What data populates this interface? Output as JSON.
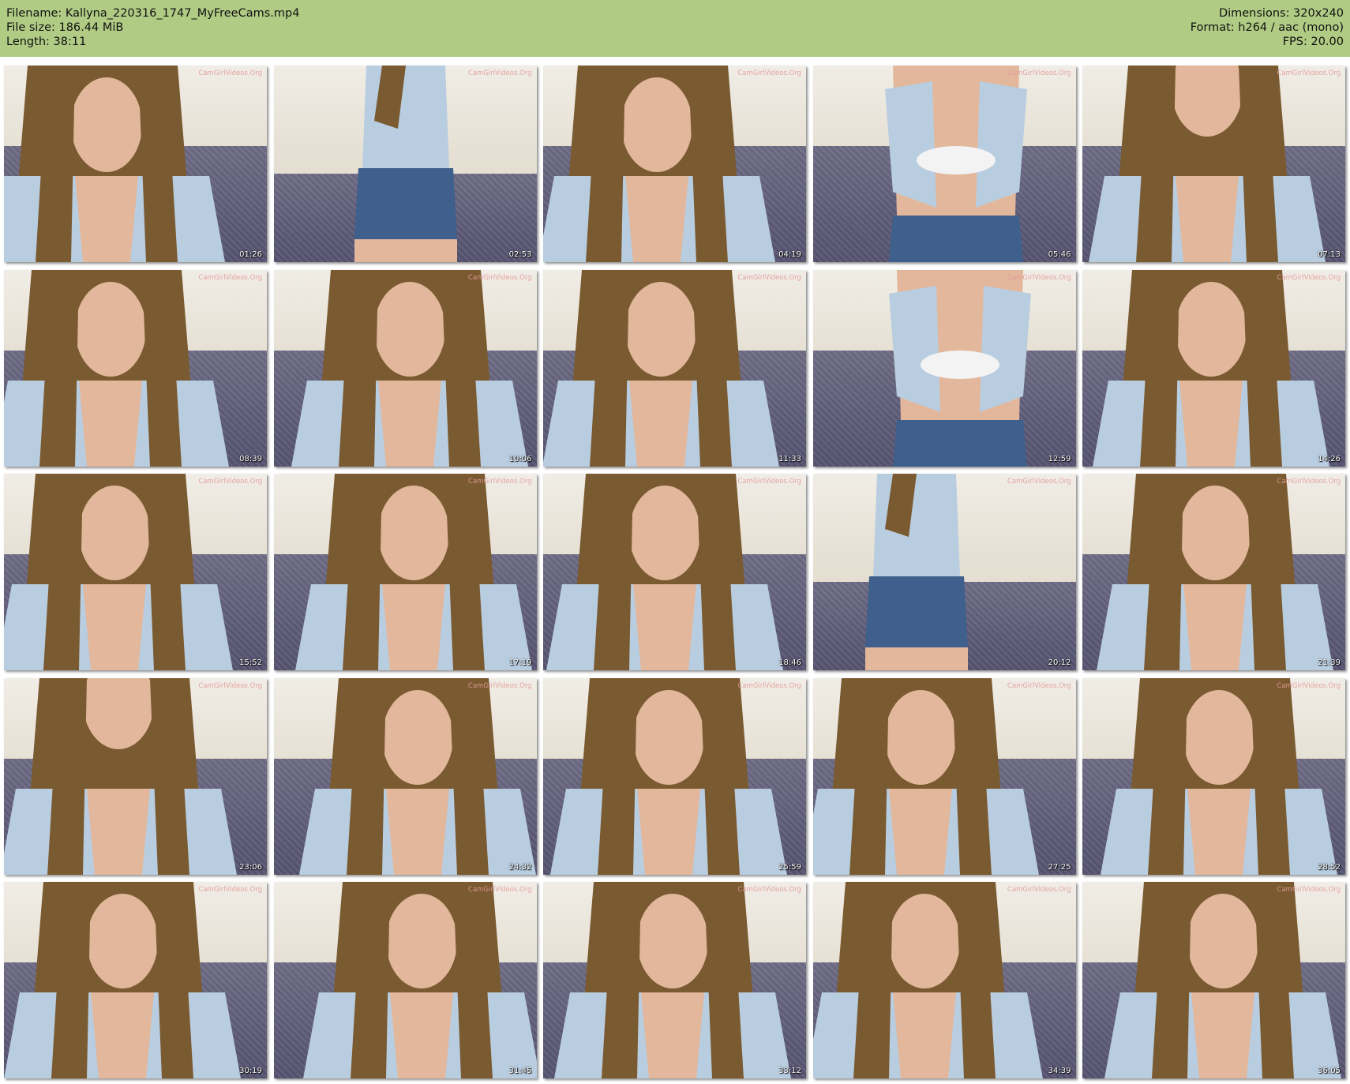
{
  "header": {
    "filename": "Filename: Kallyna_220316_1747_MyFreeCams.mp4",
    "filesize": "File size: 186.44 MiB",
    "length": "Length: 38:11",
    "dimensions": "Dimensions: 320x240",
    "format": "Format: h264 / aac (mono)",
    "fps": "FPS: 20.00"
  },
  "watermark": "CamGirlVideos.Org",
  "colors": {
    "header_bg": "#b0cc84",
    "sofa": "#5e5c78",
    "wall": "#e7e1d5",
    "hair": "#7a5a30",
    "shirt": "#b9cde0",
    "skin": "#e2b79c",
    "shorts": "#3f5f8c"
  },
  "thumbnails": [
    {
      "time": "01:26",
      "pose": "face"
    },
    {
      "time": "02:53",
      "pose": "back"
    },
    {
      "time": "04:19",
      "pose": "face"
    },
    {
      "time": "05:46",
      "pose": "standing"
    },
    {
      "time": "07:13",
      "pose": "close"
    },
    {
      "time": "08:39",
      "pose": "face"
    },
    {
      "time": "10:06",
      "pose": "pose"
    },
    {
      "time": "11:33",
      "pose": "sitting"
    },
    {
      "time": "12:59",
      "pose": "standing"
    },
    {
      "time": "14:26",
      "pose": "face"
    },
    {
      "time": "15:52",
      "pose": "face"
    },
    {
      "time": "17:19",
      "pose": "face"
    },
    {
      "time": "18:46",
      "pose": "face"
    },
    {
      "time": "20:12",
      "pose": "back"
    },
    {
      "time": "21:39",
      "pose": "face"
    },
    {
      "time": "23:06",
      "pose": "close"
    },
    {
      "time": "24:32",
      "pose": "face"
    },
    {
      "time": "25:59",
      "pose": "face"
    },
    {
      "time": "27:25",
      "pose": "face"
    },
    {
      "time": "28:52",
      "pose": "face"
    },
    {
      "time": "30:19",
      "pose": "face"
    },
    {
      "time": "31:45",
      "pose": "face"
    },
    {
      "time": "33:12",
      "pose": "face"
    },
    {
      "time": "34:39",
      "pose": "face"
    },
    {
      "time": "36:05",
      "pose": "face"
    }
  ]
}
